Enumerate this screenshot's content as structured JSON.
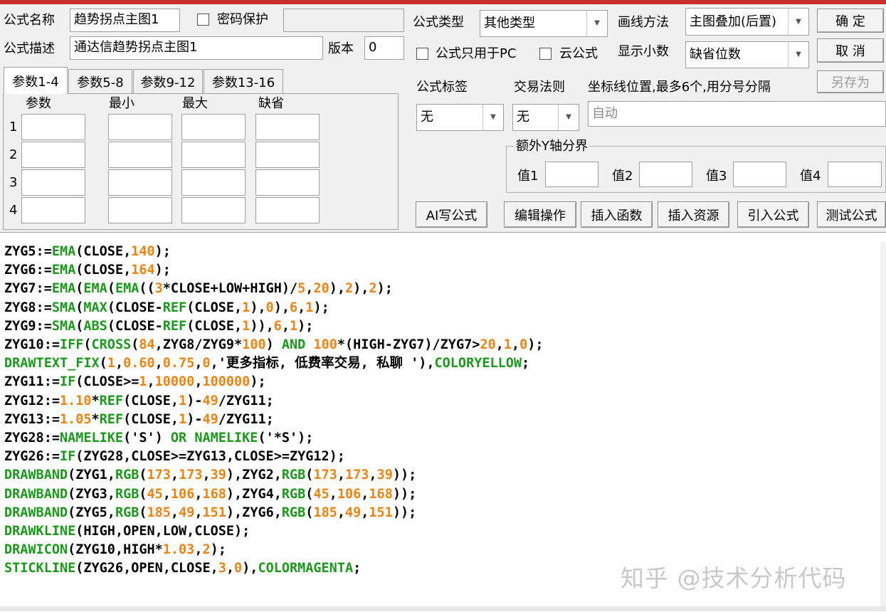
{
  "form": {
    "name_label": "公式名称",
    "name_value": "趋势拐点主图1",
    "password_label": "密码保护",
    "desc_label": "公式描述",
    "desc_value": "通达信趋势拐点主图1",
    "version_label": "版本",
    "version_value": "0",
    "type_label": "公式类型",
    "type_value": "其他类型",
    "draw_label": "画线方法",
    "draw_value": "主图叠加(后置)",
    "pc_only_label": "公式只用于PC",
    "cloud_label": "云公式",
    "decimal_label": "显示小数",
    "decimal_value": "缺省位数",
    "tag_label": "公式标签",
    "tag_value": "无",
    "rule_label": "交易法则",
    "rule_value": "无",
    "coord_label": "坐标线位置,最多6个,用分号分隔",
    "coord_value": "自动",
    "extra_y_label": "额外Y轴分界",
    "val_labels": [
      "值1",
      "值2",
      "值3",
      "值4"
    ]
  },
  "buttons": {
    "ok": "确  定",
    "cancel": "取  消",
    "save_as": "另存为",
    "ai": "AI写公式",
    "edit": "编辑操作",
    "insert_func": "插入函数",
    "insert_res": "插入资源",
    "import": "引入公式",
    "test": "测试公式"
  },
  "tabs": [
    "参数1-4",
    "参数5-8",
    "参数9-12",
    "参数13-16"
  ],
  "params": {
    "headers": [
      "参数",
      "最小",
      "最大",
      "缺省"
    ],
    "rows": [
      "1",
      "2",
      "3",
      "4"
    ]
  },
  "code_lines": [
    "ZYG5:=EMA(CLOSE,140);",
    "ZYG6:=EMA(CLOSE,164);",
    "ZYG7:=EMA(EMA(EMA((3*CLOSE+LOW+HIGH)/5,20),2),2);",
    "ZYG8:=SMA(MAX(CLOSE-REF(CLOSE,1),0),6,1);",
    "ZYG9:=SMA(ABS(CLOSE-REF(CLOSE,1)),6,1);",
    "ZYG10:=IFF(CROSS(84,ZYG8/ZYG9*100) AND 100*(HIGH-ZYG7)/ZYG7>20,1,0);",
    "DRAWTEXT_FIX(1,0.60,0.75,0,'更多指标, 低费率交易, 私聊 '),COLORYELLOW;",
    "ZYG11:=IF(CLOSE>=1,10000,100000);",
    "ZYG12:=1.10*REF(CLOSE,1)-49/ZYG11;",
    "ZYG13:=1.05*REF(CLOSE,1)-49/ZYG11;",
    "ZYG28:=NAMELIKE('S') OR NAMELIKE('*S');",
    "ZYG26:=IF(ZYG28,CLOSE>=ZYG13,CLOSE>=ZYG12);",
    "DRAWBAND(ZYG1,RGB(173,173,39),ZYG2,RGB(173,173,39));",
    "DRAWBAND(ZYG3,RGB(45,106,168),ZYG4,RGB(45,106,168));",
    "DRAWBAND(ZYG5,RGB(185,49,151),ZYG6,RGB(185,49,151));",
    "DRAWKLINE(HIGH,OPEN,LOW,CLOSE);",
    "DRAWICON(ZYG10,HIGH*1.03,2);",
    "STICKLINE(ZYG26,OPEN,CLOSE,3,0),COLORMAGENTA;"
  ],
  "watermark": "知乎 @技术分析代码",
  "colors": {
    "function": "#1a9a1a",
    "number": "#f0820f",
    "title_bar": "#c8302c"
  }
}
